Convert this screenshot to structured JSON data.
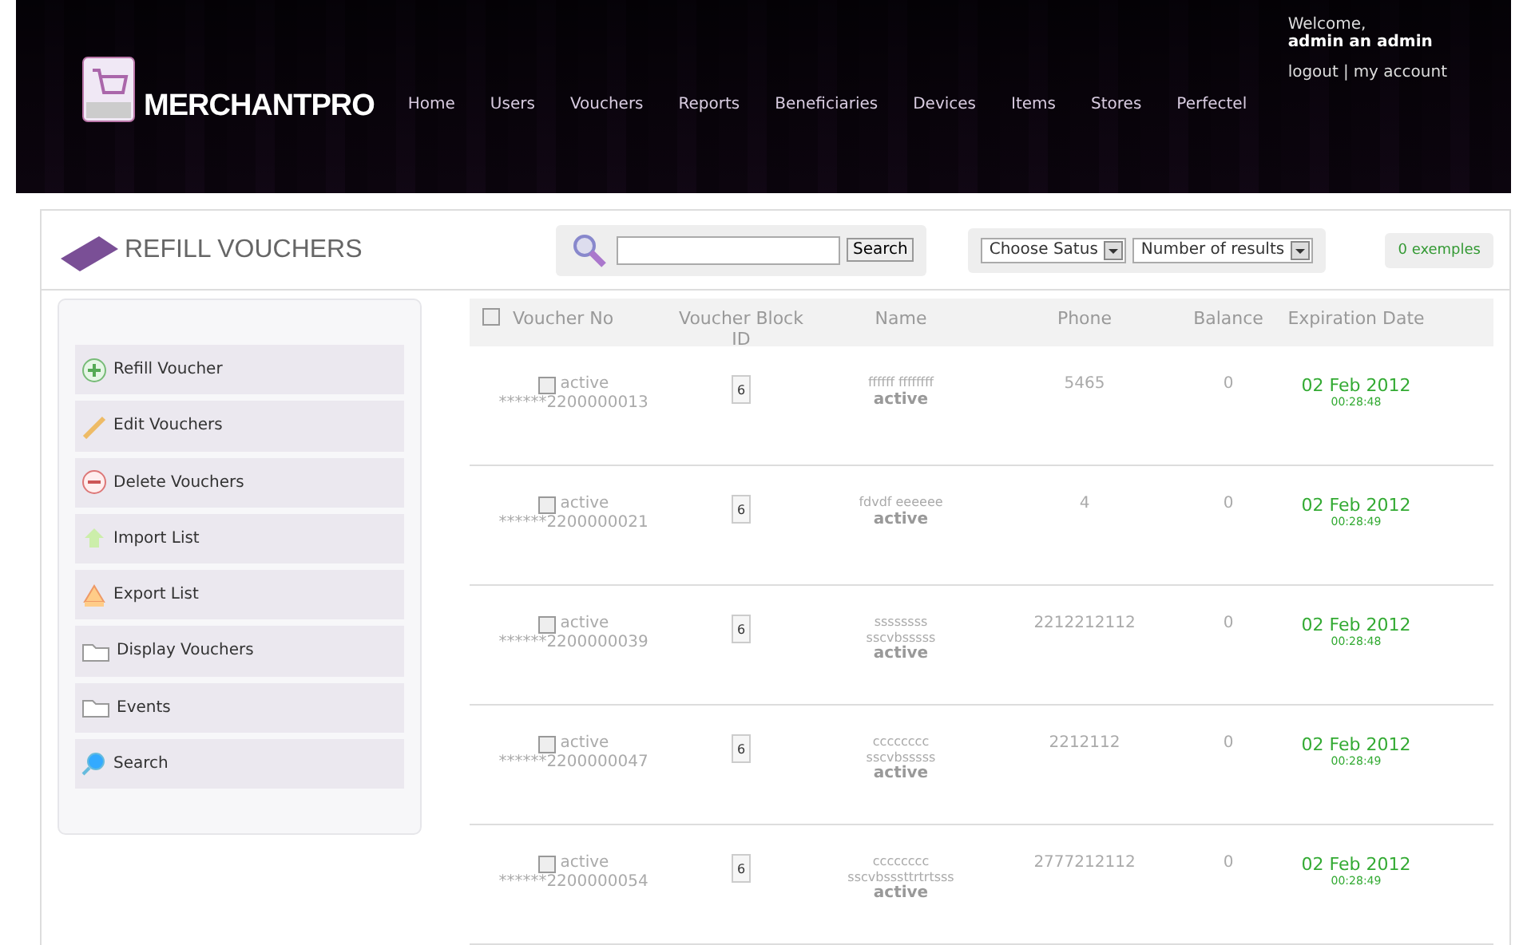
{
  "header": {
    "logo": "MERCHANTPRO",
    "nav": [
      {
        "label": "Home",
        "selected": false
      },
      {
        "label": "Users",
        "selected": false
      },
      {
        "label": "Vouchers",
        "selected": false
      },
      {
        "label": "Reports",
        "selected": false
      },
      {
        "label": "Beneficiaries",
        "selected": false
      },
      {
        "label": "Devices",
        "selected": false
      },
      {
        "label": "Items",
        "selected": false
      },
      {
        "label": "Stores",
        "selected": false
      },
      {
        "label": "Perfectel",
        "selected": false
      }
    ],
    "welcome": "Welcome,",
    "user": "admin an admin",
    "logout": "logout",
    "separator": "|",
    "account": "my account"
  },
  "toolbar": {
    "title": "REFILL VOUCHERS",
    "search_button": "Search",
    "status_select": "Choose Satus",
    "results_select": "Number of results",
    "count_badge": "0 exemples"
  },
  "sidebar": {
    "items": [
      {
        "label": "Refill Voucher",
        "kind": "add"
      },
      {
        "label": "Edit Vouchers",
        "kind": "edit"
      },
      {
        "label": "Delete Vouchers",
        "kind": "delete"
      },
      {
        "label": "Import List",
        "kind": "import"
      },
      {
        "label": "Export List",
        "kind": "export"
      },
      {
        "label": "Display Vouchers",
        "kind": "folder"
      },
      {
        "label": "Events",
        "kind": "folder"
      },
      {
        "label": "Search",
        "kind": "search"
      }
    ]
  },
  "table": {
    "columns": [
      "Voucher No",
      "Voucher Block ID",
      "Name",
      "Phone",
      "Balance",
      "Expiration Date"
    ],
    "select_all": false,
    "rows": [
      {
        "checked": false,
        "status": "active",
        "voucher_no": "******2200000013",
        "block": "6",
        "name": [
          "ffffff ffffffff"
        ],
        "name_status": "active",
        "phone": "5465",
        "balance": "0",
        "date": "02 Feb 2012",
        "time": "00:28:48"
      },
      {
        "checked": false,
        "status": "active",
        "voucher_no": "******2200000021",
        "block": "6",
        "name": [
          "fdvdf eeeeee"
        ],
        "name_status": "active",
        "phone": "4",
        "balance": "0",
        "date": "02 Feb 2012",
        "time": "00:28:49"
      },
      {
        "checked": false,
        "status": "active",
        "voucher_no": "******2200000039",
        "block": "6",
        "name": [
          "ssssssss",
          "sscvbsssss"
        ],
        "name_status": "active",
        "phone": "2212212112",
        "balance": "0",
        "date": "02 Feb 2012",
        "time": "00:28:48"
      },
      {
        "checked": false,
        "status": "active",
        "voucher_no": "******2200000047",
        "block": "6",
        "name": [
          "cccccccc",
          "sscvbsssss"
        ],
        "name_status": "active",
        "phone": "2212112",
        "balance": "0",
        "date": "02 Feb 2012",
        "time": "00:28:49"
      },
      {
        "checked": false,
        "status": "active",
        "voucher_no": "******2200000054",
        "block": "6",
        "name": [
          "cccccccc",
          "sscvbsssttrtrtsss"
        ],
        "name_status": "active",
        "phone": "2777212112",
        "balance": "0",
        "date": "02 Feb 2012",
        "time": "00:28:49"
      }
    ]
  }
}
